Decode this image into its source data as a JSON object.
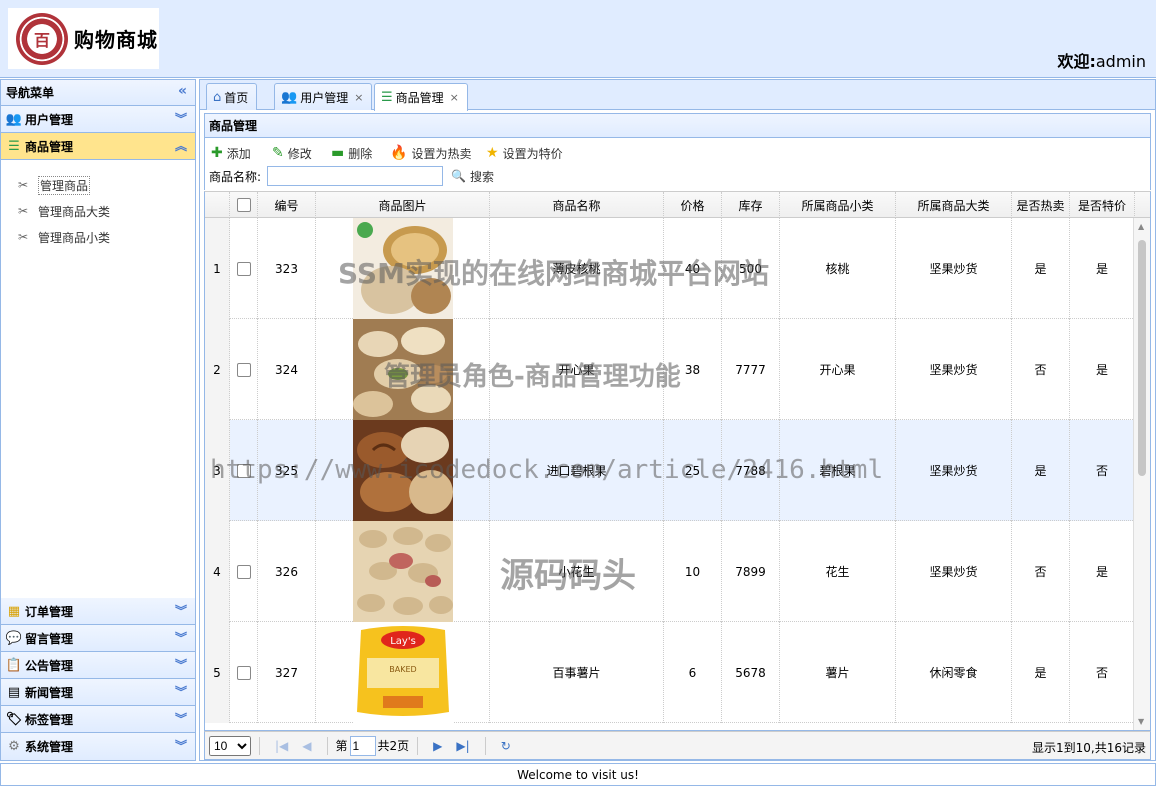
{
  "header": {
    "brand": "购物商城",
    "logo_seal_char": "百",
    "welcome_prefix": "欢迎:",
    "username": "admin"
  },
  "sidebar": {
    "title": "导航菜单",
    "top_menus": [
      {
        "label": "用户管理",
        "icon": "users-icon"
      },
      {
        "label": "商品管理",
        "icon": "list-icon"
      }
    ],
    "sub_items": [
      "管理商品",
      "管理商品大类",
      "管理商品小类"
    ],
    "bottom_menus": [
      {
        "label": "订单管理",
        "icon": "order-icon"
      },
      {
        "label": "留言管理",
        "icon": "comment-icon"
      },
      {
        "label": "公告管理",
        "icon": "notice-icon"
      },
      {
        "label": "新闻管理",
        "icon": "news-icon"
      },
      {
        "label": "标签管理",
        "icon": "tag-icon"
      },
      {
        "label": "系统管理",
        "icon": "gear-icon"
      }
    ]
  },
  "tabs": [
    {
      "label": "首页",
      "icon": "home-icon",
      "closable": false
    },
    {
      "label": "用户管理",
      "icon": "users-icon",
      "closable": true
    },
    {
      "label": "商品管理",
      "icon": "list-icon",
      "closable": true
    }
  ],
  "panel": {
    "title": "商品管理"
  },
  "toolbar": {
    "add": "添加",
    "edit": "修改",
    "delete": "删除",
    "set_hot": "设置为热卖",
    "set_special": "设置为特价",
    "search_label": "商品名称:",
    "search_value": "",
    "search_button": "搜索"
  },
  "grid": {
    "columns": [
      "编号",
      "商品图片",
      "商品名称",
      "价格",
      "库存",
      "所属商品小类",
      "所属商品大类",
      "是否热卖",
      "是否特价"
    ],
    "rows": [
      {
        "num": "1",
        "id": "323",
        "name": "薄皮核桃",
        "price": "40",
        "stock": "500",
        "sub": "核桃",
        "cat": "坚果炒货",
        "hot": "是",
        "special": "是",
        "img": "walnut"
      },
      {
        "num": "2",
        "id": "324",
        "name": "开心果",
        "price": "38",
        "stock": "7777",
        "sub": "开心果",
        "cat": "坚果炒货",
        "hot": "否",
        "special": "是",
        "img": "pistachio"
      },
      {
        "num": "3",
        "id": "325",
        "name": "进口碧根果",
        "price": "25",
        "stock": "7788",
        "sub": "碧根果",
        "cat": "坚果炒货",
        "hot": "是",
        "special": "否",
        "img": "pecan"
      },
      {
        "num": "4",
        "id": "326",
        "name": "小花生",
        "price": "10",
        "stock": "7899",
        "sub": "花生",
        "cat": "坚果炒货",
        "hot": "否",
        "special": "是",
        "img": "peanut"
      },
      {
        "num": "5",
        "id": "327",
        "name": "百事薯片",
        "price": "6",
        "stock": "5678",
        "sub": "薯片",
        "cat": "休闲零食",
        "hot": "是",
        "special": "否",
        "img": "chips"
      }
    ]
  },
  "pager": {
    "page_size": "10",
    "page_prefix": "第",
    "page_value": "1",
    "page_suffix": "共2页",
    "info": "显示1到10,共16记录"
  },
  "footer": {
    "text": "Welcome to visit us!"
  },
  "watermarks": {
    "line1": "SSM实现的在线网络商城平台网站",
    "line2": "管理员角色-商品管理功能",
    "line3": "https://www.icodedock.com/article/2416.html",
    "line4": "源码码头"
  },
  "colors": {
    "header_bg": "#e0ecff",
    "border": "#95b8e7",
    "selected_menu": "#ffe48d",
    "highlight_row": "#eaf2ff"
  }
}
